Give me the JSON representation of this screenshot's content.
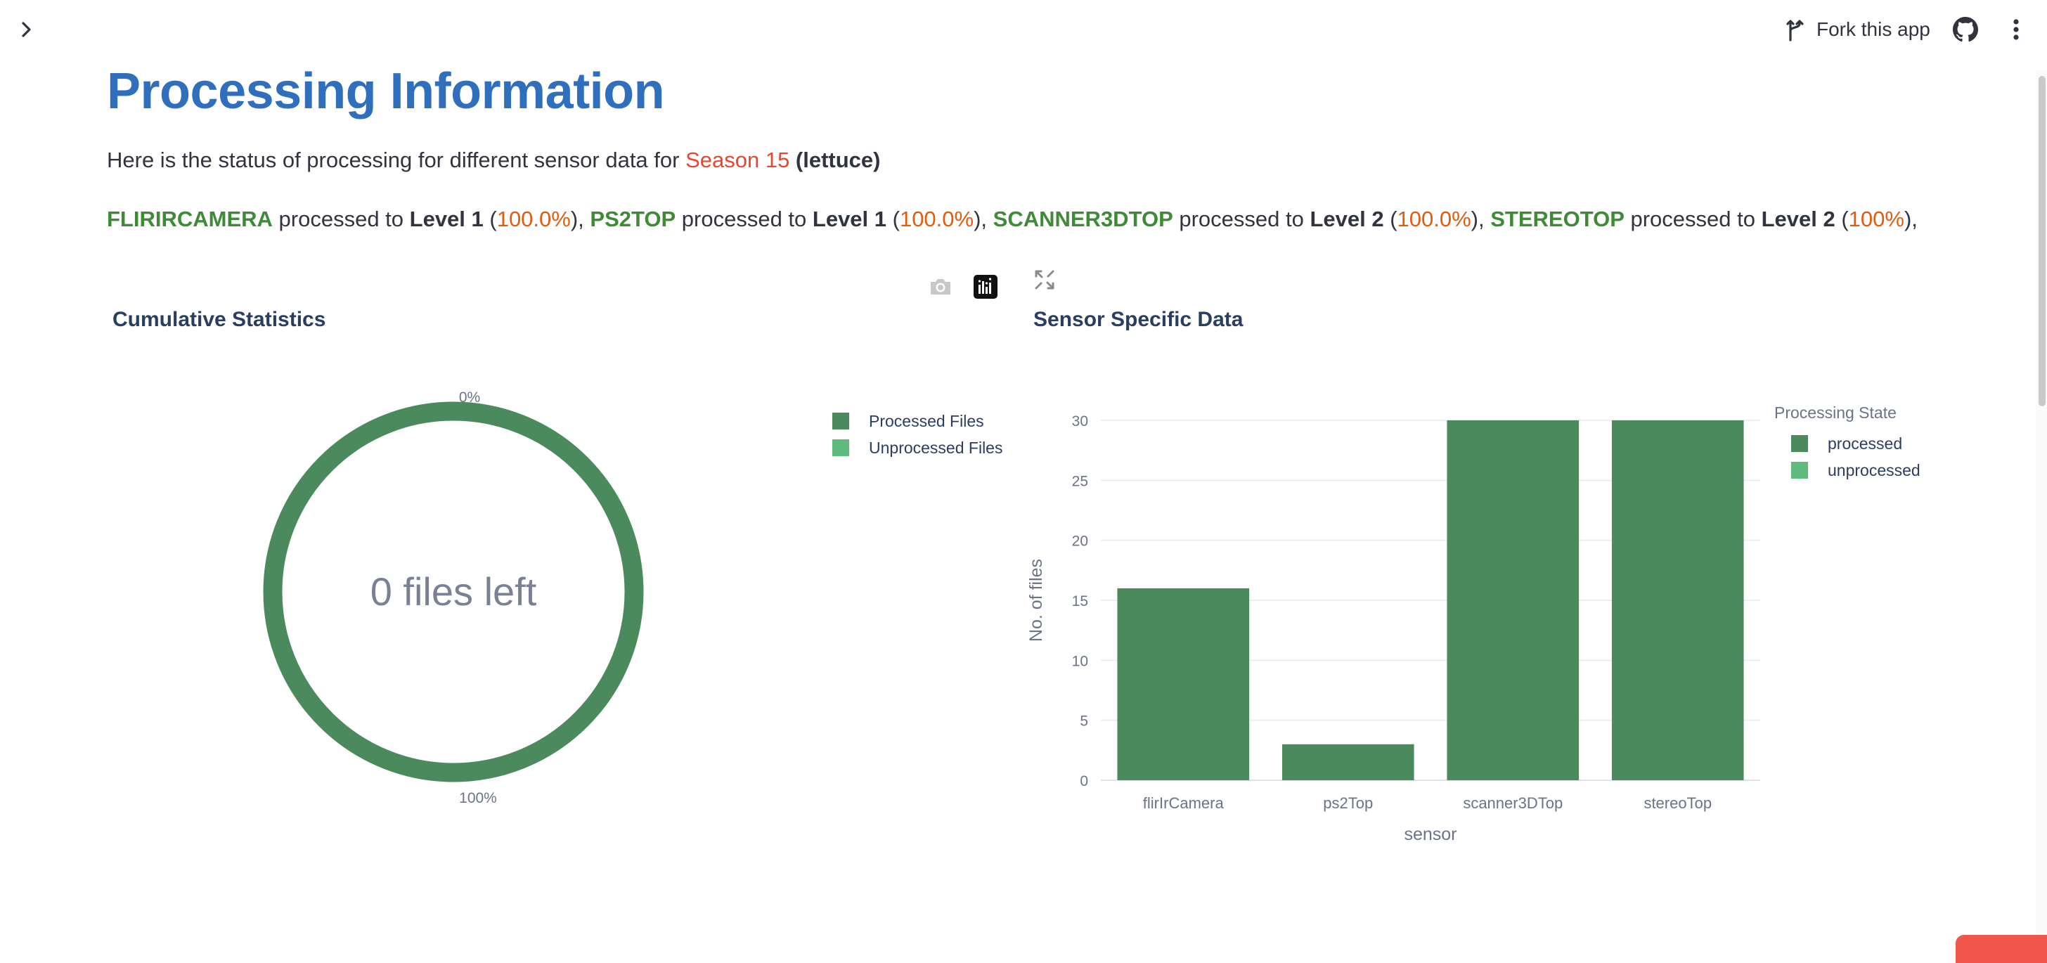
{
  "header": {
    "fork_label": "Fork this app",
    "icons": [
      "chevron-right-icon",
      "fork-icon",
      "github-icon",
      "more-vertical-icon"
    ]
  },
  "page": {
    "title": "Processing Information",
    "intro_prefix": "Here is the status of processing for different sensor data for ",
    "season": "Season 15",
    "crop_open": " (",
    "crop": "lettuce",
    "crop_close": ")"
  },
  "status": {
    "processed_to": " processed to ",
    "items": [
      {
        "sensor": "FLIRIRCAMERA",
        "level": "Level 1",
        "pct": "100.0%"
      },
      {
        "sensor": "PS2TOP",
        "level": "Level 1",
        "pct": "100.0%"
      },
      {
        "sensor": "SCANNER3DTOP",
        "level": "Level 2",
        "pct": "100.0%"
      },
      {
        "sensor": "STEREOTOP",
        "level": "Level 2",
        "pct": "100%"
      }
    ]
  },
  "colors": {
    "title": "#2f6fbd",
    "processed": "#4a8a5c",
    "unprocessed": "#5fba7d",
    "text_red": "#e8462e",
    "text_orange": "#e05d0f",
    "sensor_green": "#3f8a36"
  },
  "modebar": [
    "camera-icon",
    "plotly-logo-icon",
    "fullscreen-icon"
  ],
  "chart_data": [
    {
      "type": "pie",
      "title": "Cumulative Statistics",
      "hole_text": "0 files left",
      "labels": [
        "Processed Files",
        "Unprocessed Files"
      ],
      "values": [
        79,
        0
      ],
      "slice_labels": [
        "100%",
        "0%"
      ],
      "legend_position": "top-right"
    },
    {
      "type": "bar",
      "title": "Sensor Specific Data",
      "categories": [
        "flirIrCamera",
        "ps2Top",
        "scanner3DTop",
        "stereoTop"
      ],
      "series": [
        {
          "name": "processed",
          "values": [
            16,
            3,
            30,
            30
          ]
        },
        {
          "name": "unprocessed",
          "values": [
            0,
            0,
            0,
            0
          ]
        }
      ],
      "xlabel": "sensor",
      "ylabel": "No. of files",
      "ylim": [
        0,
        30
      ],
      "yticks": [
        0,
        5,
        10,
        15,
        20,
        25,
        30
      ],
      "legend_title": "Processing State",
      "legend_position": "top-right",
      "grid": true
    }
  ]
}
